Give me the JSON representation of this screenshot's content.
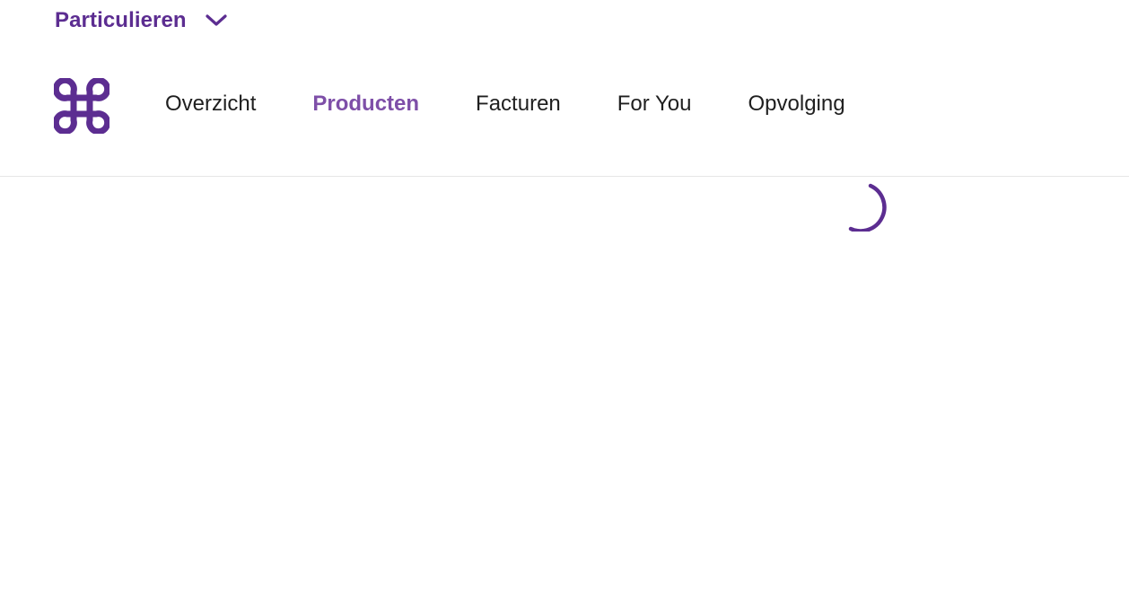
{
  "segment": {
    "label": "Particulieren",
    "chevron_icon": "chevron-down-icon"
  },
  "brand": {
    "logo_icon": "proximus-logo-icon",
    "color": "#5c2d91"
  },
  "nav": {
    "items": [
      {
        "label": "Overzicht",
        "active": false
      },
      {
        "label": "Producten",
        "active": true
      },
      {
        "label": "Facturen",
        "active": false
      },
      {
        "label": "For You",
        "active": false
      },
      {
        "label": "Opvolging",
        "active": false
      }
    ],
    "active_color": "#7e4fa8"
  },
  "content": {
    "loading_icon": "loading-spinner-icon"
  }
}
